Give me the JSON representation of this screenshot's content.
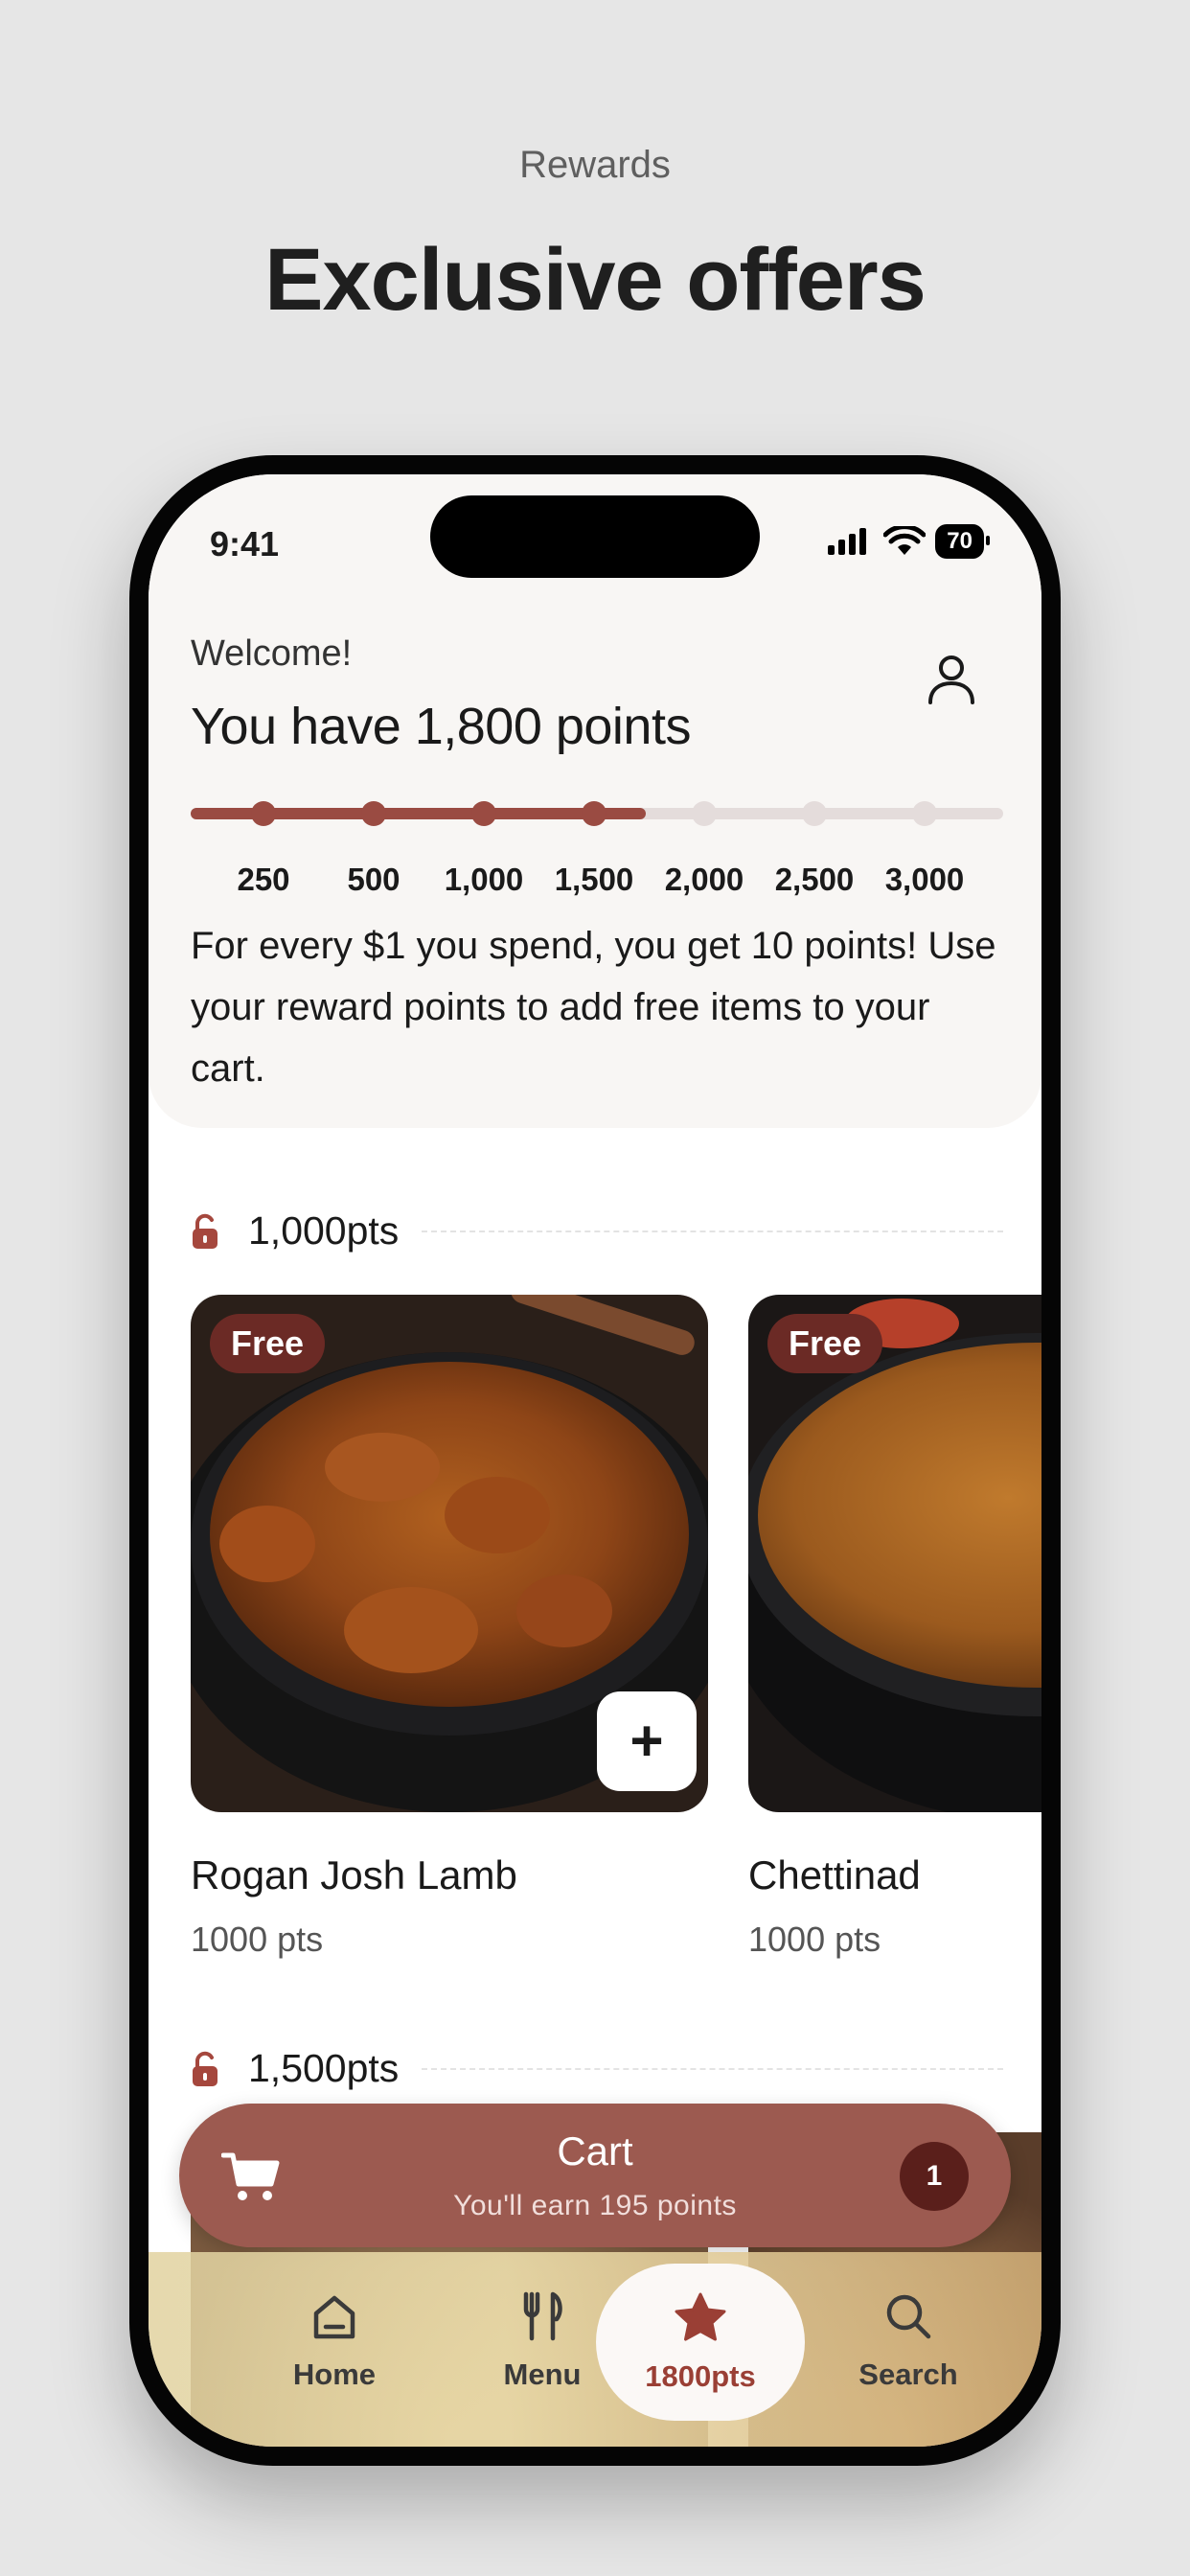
{
  "page": {
    "kicker": "Rewards",
    "title": "Exclusive offers"
  },
  "status": {
    "time": "9:41",
    "battery": "70"
  },
  "header": {
    "welcome": "Welcome!",
    "points_title": "You have 1,800 points",
    "progress_fraction": 0.56,
    "milestones": [
      "250",
      "500",
      "1,000",
      "1,500",
      "2,000",
      "2,500",
      "3,000"
    ],
    "milestones_reached": 4,
    "info": "For every $1 you spend, you get 10 points! Use your reward points to add free items to your cart."
  },
  "sections": [
    {
      "label": "1,000pts",
      "items": [
        {
          "badge": "Free",
          "name": "Rogan Josh Lamb",
          "points": "1000 pts",
          "add_label": "+"
        },
        {
          "badge": "Free",
          "name": "Chettinad",
          "points": "1000 pts"
        }
      ]
    },
    {
      "label": "1,500pts"
    }
  ],
  "cart": {
    "title": "Cart",
    "subtitle": "You'll earn 195 points",
    "count": "1"
  },
  "tabs": [
    {
      "label": "Home",
      "icon": "home-icon"
    },
    {
      "label": "Menu",
      "icon": "fork-knife-icon"
    },
    {
      "label": "1800pts",
      "icon": "star-icon",
      "active": true
    },
    {
      "label": "Search",
      "icon": "search-icon"
    }
  ],
  "colors": {
    "accent": "#9a4b42",
    "cart": "#9c5a50",
    "badge": "#6b2a25",
    "track": "#e4dcdb"
  }
}
